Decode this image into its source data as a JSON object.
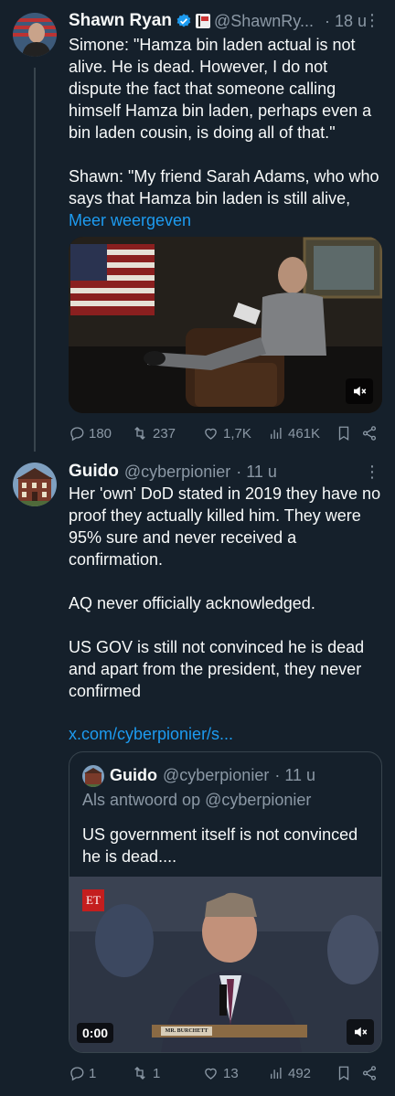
{
  "tweet1": {
    "name": "Shawn Ryan",
    "handle": "@ShawnRy...",
    "time": "· 18 u",
    "text": "Simone: \"Hamza bin laden actual is not alive. He is dead. However, I do not dispute the fact that someone calling himself Hamza bin laden, perhaps even a bin laden cousin, is doing all of that.\"\n\nShawn: \"My friend Sarah Adams, who who says that Hamza bin laden is still alive, ",
    "show_more": "Meer weergeven",
    "replies": "180",
    "reposts": "237",
    "likes": "1,7K",
    "views": "461K"
  },
  "tweet2": {
    "name": "Guido",
    "handle": "@cyberpionier",
    "time": "· 11 u",
    "text": "Her 'own' DoD stated in 2019 they have no proof they actually killed him. They were 95% sure and never received a confirmation.\n\nAQ never officially acknowledged.\n\nUS GOV is still not convinced he is dead and apart from the president, they never confirmed",
    "link": "x.com/cyberpionier/s...",
    "replies": "1",
    "reposts": "1",
    "likes": "13",
    "views": "492"
  },
  "quote": {
    "name": "Guido",
    "handle": "@cyberpionier",
    "time": "· 11 u",
    "reply_to": "Als antwoord op @cyberpionier",
    "text": "US government itself is not convinced he is dead....",
    "video_time": "0:00",
    "et_logo": "ET",
    "nameplate": "MR. BURCHETT"
  },
  "colors": {
    "background": "#15202b",
    "text": "#f7f9f9",
    "secondary": "#8b98a5",
    "accent": "#1d9bf0",
    "border": "#38444d"
  }
}
